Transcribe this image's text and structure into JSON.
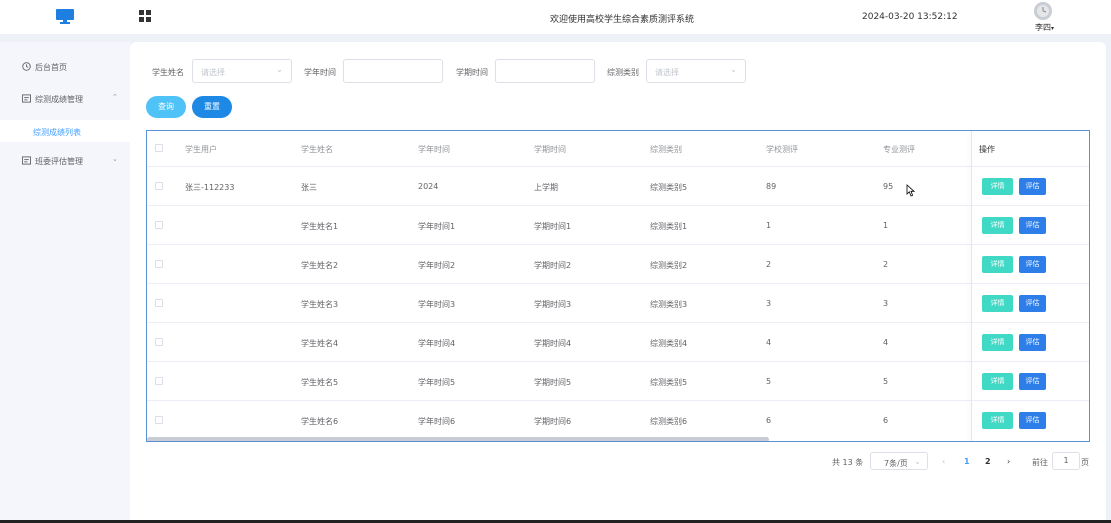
{
  "header": {
    "system_title": "欢迎使用高校学生综合素质测评系统",
    "datetime": "2024-03-20 13:52:12",
    "user_name": "李四",
    "user_menu_arrow": "▾",
    "logo_icon": "monitor-icon",
    "apps_icon": "grid-icon"
  },
  "sidebar": {
    "items": [
      {
        "label": "后台首页",
        "icon": "clock-icon",
        "arrow": ""
      },
      {
        "label": "综测成绩管理",
        "icon": "document-icon",
        "arrow": "⌃"
      },
      {
        "label": "班委评估管理",
        "icon": "document-icon",
        "arrow": "⌄"
      }
    ],
    "sub_items": [
      {
        "label": "综测成绩列表",
        "active": true
      }
    ],
    "active_color": "#409eff"
  },
  "filters": {
    "student_name_label": "学生姓名",
    "student_name_placeholder": "请选择",
    "year_label": "学年时间",
    "year_value": "",
    "term_label": "学期时间",
    "term_value": "",
    "category_label": "综测类别",
    "category_placeholder": "请选择",
    "dropdown_arrow": "⌄"
  },
  "actions": {
    "query_label": "查询",
    "reset_label": "重置"
  },
  "table": {
    "columns": [
      "学生用户",
      "学生姓名",
      "学年时间",
      "学期时间",
      "综测类别",
      "学校测评",
      "专业测评",
      "操作"
    ],
    "rows": [
      {
        "user": "张三-112233",
        "name": "张三",
        "year": "2024",
        "term": "上学期",
        "category": "综测类别5",
        "school": "89",
        "major": "95"
      },
      {
        "user": "",
        "name": "学生姓名1",
        "year": "学年时间1",
        "term": "学期时间1",
        "category": "综测类别1",
        "school": "1",
        "major": "1"
      },
      {
        "user": "",
        "name": "学生姓名2",
        "year": "学年时间2",
        "term": "学期时间2",
        "category": "综测类别2",
        "school": "2",
        "major": "2"
      },
      {
        "user": "",
        "name": "学生姓名3",
        "year": "学年时间3",
        "term": "学期时间3",
        "category": "综测类别3",
        "school": "3",
        "major": "3"
      },
      {
        "user": "",
        "name": "学生姓名4",
        "year": "学年时间4",
        "term": "学期时间4",
        "category": "综测类别4",
        "school": "4",
        "major": "4"
      },
      {
        "user": "",
        "name": "学生姓名5",
        "year": "学年时间5",
        "term": "学期时间5",
        "category": "综测类别5",
        "school": "5",
        "major": "5"
      },
      {
        "user": "",
        "name": "学生姓名6",
        "year": "学年时间6",
        "term": "学期时间6",
        "category": "综测类别6",
        "school": "6",
        "major": "6"
      }
    ],
    "detail_label": "详情",
    "evaluate_label": "评估"
  },
  "pagination": {
    "total": "共 13 条",
    "page_size": "7条/页",
    "prev": "‹",
    "pages": [
      "1",
      "2"
    ],
    "current_page": "1",
    "next": "›",
    "goto_label": "前往",
    "goto_value": "1",
    "page_suffix": "页",
    "active_color": "#409eff"
  }
}
